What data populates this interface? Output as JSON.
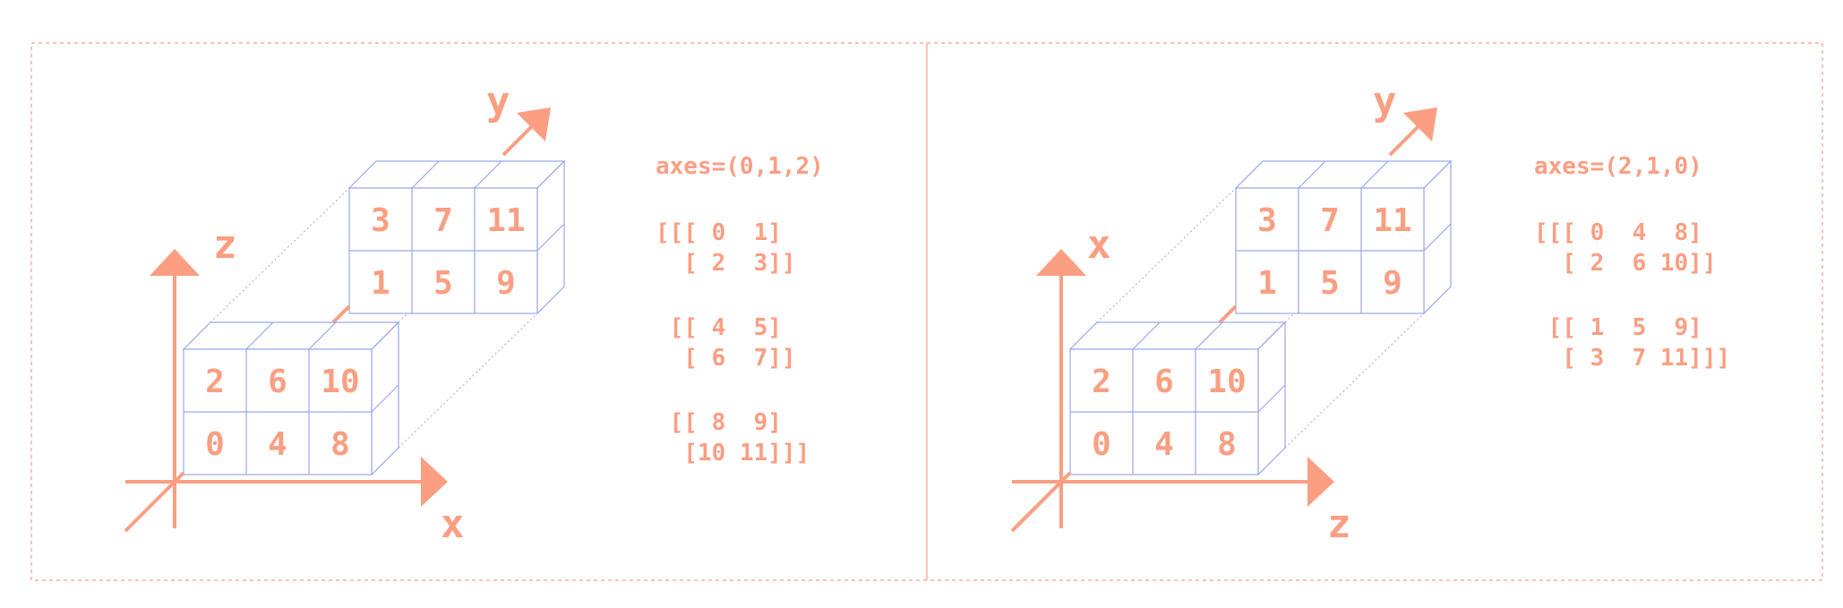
{
  "colors": {
    "accent": "#fb9e82",
    "grid": "#9aa7ee",
    "frame": "#fb9e82"
  },
  "panels": [
    {
      "axes_label": "axes=(0,1,2)",
      "axis_labels": {
        "vertical": "z",
        "horizontal": "x",
        "depth": "y"
      },
      "front_cells": [
        "2",
        "6",
        "10",
        "0",
        "4",
        "8"
      ],
      "back_cells": [
        "3",
        "7",
        "11",
        "1",
        "5",
        "9"
      ],
      "array_lines": [
        "[[[ 0  1]",
        "  [ 2  3]]",
        "",
        " [[ 4  5]",
        "  [ 6  7]]",
        "",
        " [[ 8  9]",
        "  [10 11]]]"
      ]
    },
    {
      "axes_label": "axes=(2,1,0)",
      "axis_labels": {
        "vertical": "x",
        "horizontal": "z",
        "depth": "y"
      },
      "front_cells": [
        "2",
        "6",
        "10",
        "0",
        "4",
        "8"
      ],
      "back_cells": [
        "3",
        "7",
        "11",
        "1",
        "5",
        "9"
      ],
      "array_lines": [
        "[[[ 0  4  8]",
        "  [ 2  6 10]]",
        "",
        " [[ 1  5  9]",
        "  [ 3  7 11]]]"
      ]
    }
  ]
}
